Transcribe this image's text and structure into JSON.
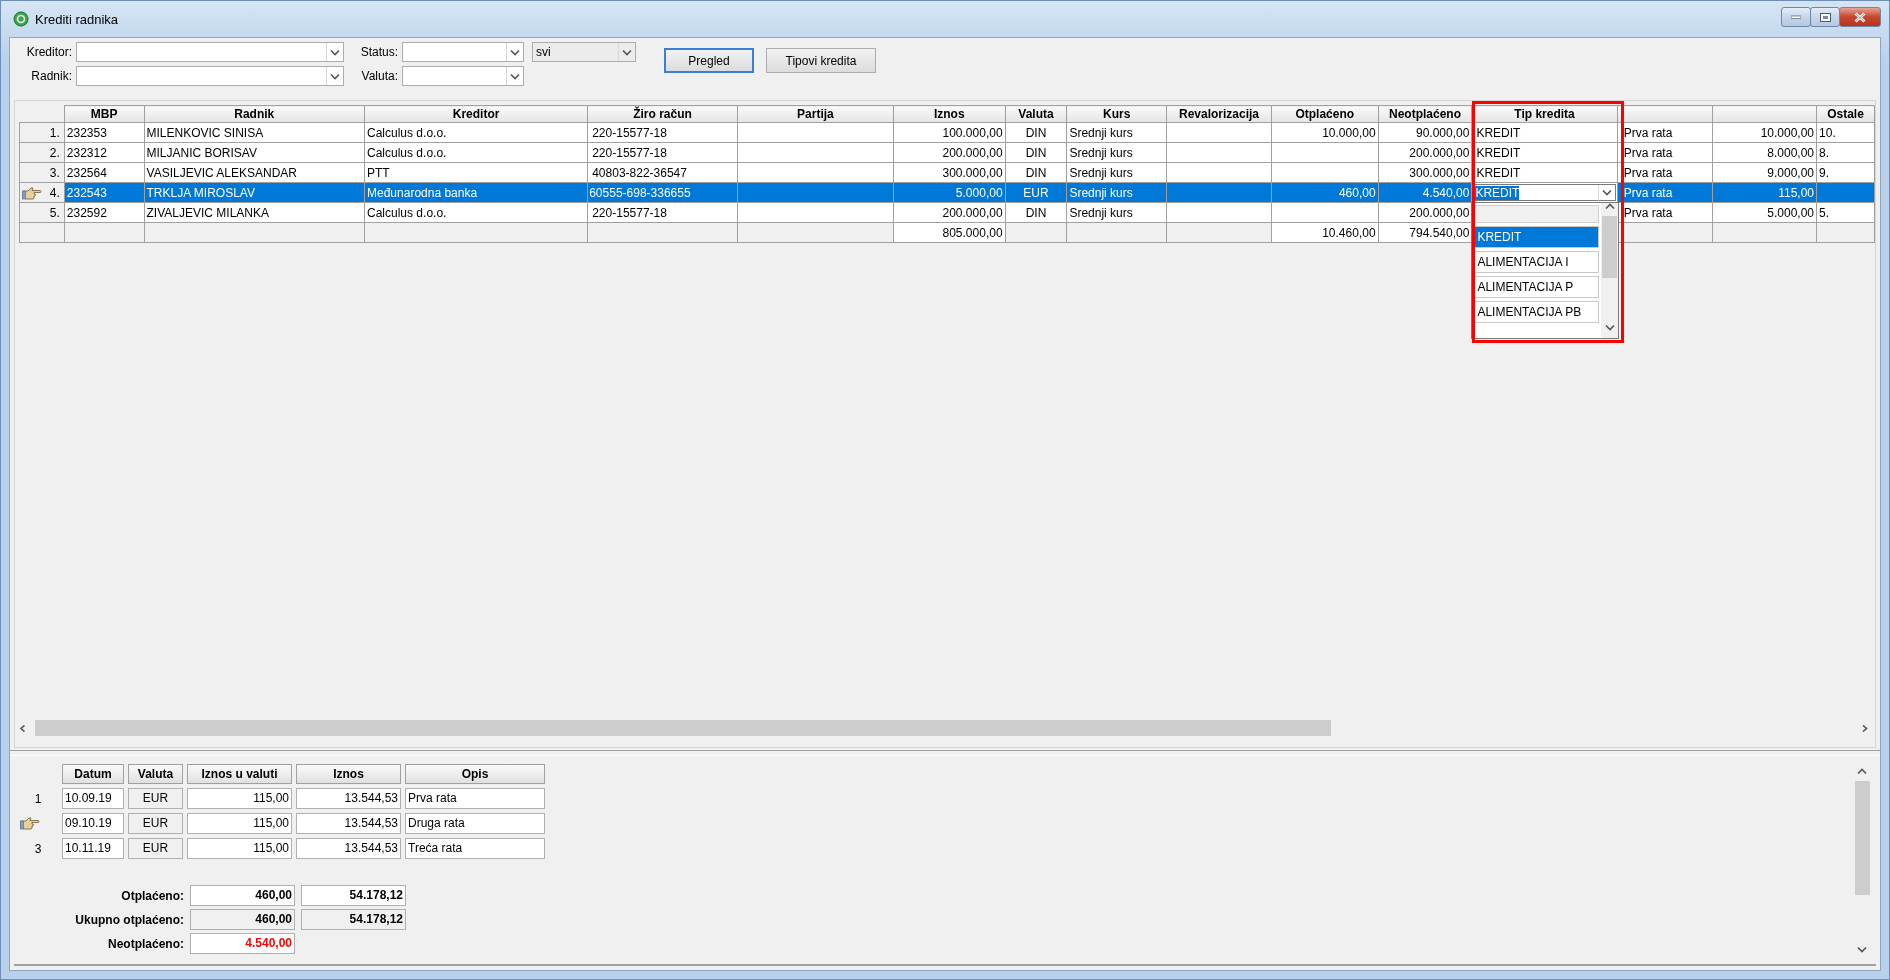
{
  "window": {
    "title": "Krediti radnika"
  },
  "filters": [
    {
      "label": "Kreditor:"
    },
    {
      "label": "Radnik:"
    },
    {
      "label": "Status:"
    },
    {
      "label": "Valuta:"
    }
  ],
  "status_scope": {
    "value": "svi"
  },
  "buttons": [
    {
      "label": "Pregled",
      "default": true
    },
    {
      "label": "Tipovi kredita",
      "default": false
    }
  ],
  "table": {
    "columns": {
      "mbp": "MBP",
      "radnik": "Radnik",
      "kreditor": "Kreditor",
      "ziro_racun": "Žiro račun",
      "partija": "Partija",
      "iznos": "Iznos",
      "valuta": "Valuta",
      "kurs": "Kurs",
      "revalorizacija": "Revalorizacija",
      "otplaceno": "Otplaćeno",
      "neotplaceno": "Neotplaćeno",
      "tip_kredita": "Tip kredita",
      "ostale": "Ostale"
    },
    "rows": [
      {
        "number": "1.",
        "selected": false,
        "current": false,
        "cells": {
          "mbp": "232353",
          "radnik": "MILENKOVIC SINISA",
          "kreditor": "Calculus d.o.o.",
          "ziro_racun": "220-15577-18",
          "iznos": "100.000,00",
          "valuta": "DIN",
          "kurs": "Srednji kurs",
          "otplaceno": "10.000,00",
          "neotplaceno": "90.000,00",
          "tip_kredita": "KREDIT",
          "column_13": "Prva rata",
          "column_14": "10.000,00",
          "ostale": "10."
        }
      },
      {
        "number": "2.",
        "selected": false,
        "current": false,
        "cells": {
          "mbp": "232312",
          "radnik": "MILJANIC BORISAV",
          "kreditor": "Calculus d.o.o.",
          "ziro_racun": "220-15577-18",
          "iznos": "200.000,00",
          "valuta": "DIN",
          "kurs": "Srednji kurs",
          "neotplaceno": "200.000,00",
          "tip_kredita": "KREDIT",
          "column_13": "Prva rata",
          "column_14": "8.000,00",
          "ostale": "8."
        }
      },
      {
        "number": "3.",
        "selected": false,
        "current": false,
        "cells": {
          "mbp": "232564",
          "radnik": "VASILJEVIC ALEKSANDAR",
          "kreditor": "PTT",
          "ziro_racun": "40803-822-36547",
          "iznos": "300.000,00",
          "valuta": "DIN",
          "kurs": "Srednji kurs",
          "neotplaceno": "300.000,00",
          "tip_kredita": "KREDIT",
          "column_13": "Prva rata",
          "column_14": "9.000,00",
          "ostale": "9."
        }
      },
      {
        "number": "4.",
        "selected": true,
        "current": true,
        "cells": {
          "mbp": "232543",
          "radnik": "TRKLJA MIROSLAV",
          "kreditor": "Međunarodna banka",
          "ziro_racun": "60555-698-336655",
          "iznos": "5.000,00",
          "valuta": "EUR",
          "kurs": "Srednji kurs",
          "otplaceno": "460,00",
          "neotplaceno": "4.540,00",
          "tip_kredita": "KREDIT",
          "column_13": "Prva rata",
          "column_14": "115,00"
        }
      },
      {
        "number": "5.",
        "selected": false,
        "current": false,
        "cells": {
          "mbp": "232592",
          "radnik": "ZIVALJEVIC MILANKA",
          "kreditor": "Calculus d.o.o.",
          "ziro_racun": "220-15577-18",
          "iznos": "200.000,00",
          "valuta": "DIN",
          "kurs": "Srednji kurs",
          "neotplaceno": "200.000,00",
          "column_13": "Prva rata",
          "column_14": "5.000,00",
          "ostale": "5."
        }
      }
    ],
    "totals": {
      "iznos": "805.000,00",
      "otplaceno": "10.460,00",
      "neotplaceno": "794.540,00"
    }
  },
  "type_dropdown": {
    "highlight_frame": true,
    "items": [
      {
        "label": "KREDIT",
        "selected": true
      },
      {
        "label": "ALIMENTACIJA I",
        "selected": false
      },
      {
        "label": "ALIMENTACIJA P",
        "selected": false
      },
      {
        "label": "ALIMENTACIJA PB",
        "selected": false
      }
    ]
  },
  "installments": {
    "columns": [
      "Datum",
      "Valuta",
      "Iznos u valuti",
      "Iznos",
      "Opis"
    ],
    "rows": [
      {
        "number": "1",
        "current": false,
        "cells": [
          "10.09.19",
          "EUR",
          "115,00",
          "13.544,53",
          "Prva rata"
        ]
      },
      {
        "current": true,
        "cells": [
          "09.10.19",
          "EUR",
          "115,00",
          "13.544,53",
          "Druga rata"
        ]
      },
      {
        "number": "3",
        "current": false,
        "cells": [
          "10.11.19",
          "EUR",
          "115,00",
          "13.544,53",
          "Treća rata"
        ]
      }
    ]
  },
  "summary": [
    {
      "label": "Otplaćeno:",
      "kind": "editable",
      "alert": false,
      "values": [
        "460,00",
        "54.178,12"
      ]
    },
    {
      "label": "Ukupno otplaćeno:",
      "kind": "readonly",
      "alert": false,
      "values": [
        "460,00",
        "54.178,12"
      ]
    },
    {
      "label": "Neotplaćeno:",
      "kind": "editable",
      "alert": true,
      "values": [
        "4.540,00"
      ]
    }
  ]
}
